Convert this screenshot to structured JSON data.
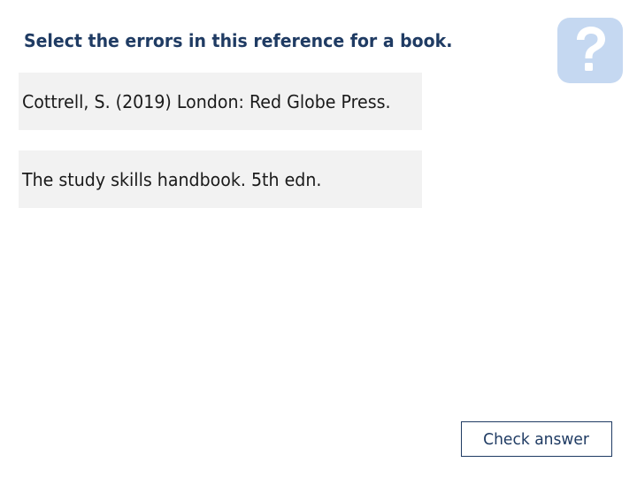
{
  "question": {
    "text": "Select the errors in this reference for a book."
  },
  "help": {
    "icon": "question-mark-icon",
    "background_color": "#c5d8f1"
  },
  "fragments": [
    {
      "label": "Cottrell, S.  (2019)  London: Red Globe Press."
    },
    {
      "label": "The study skills handbook. 5th edn."
    }
  ],
  "actions": {
    "check_label": "Check answer"
  },
  "colors": {
    "heading": "#1f3b63",
    "fragment_background": "#f2f2f2",
    "button_border": "#1f3b63"
  }
}
